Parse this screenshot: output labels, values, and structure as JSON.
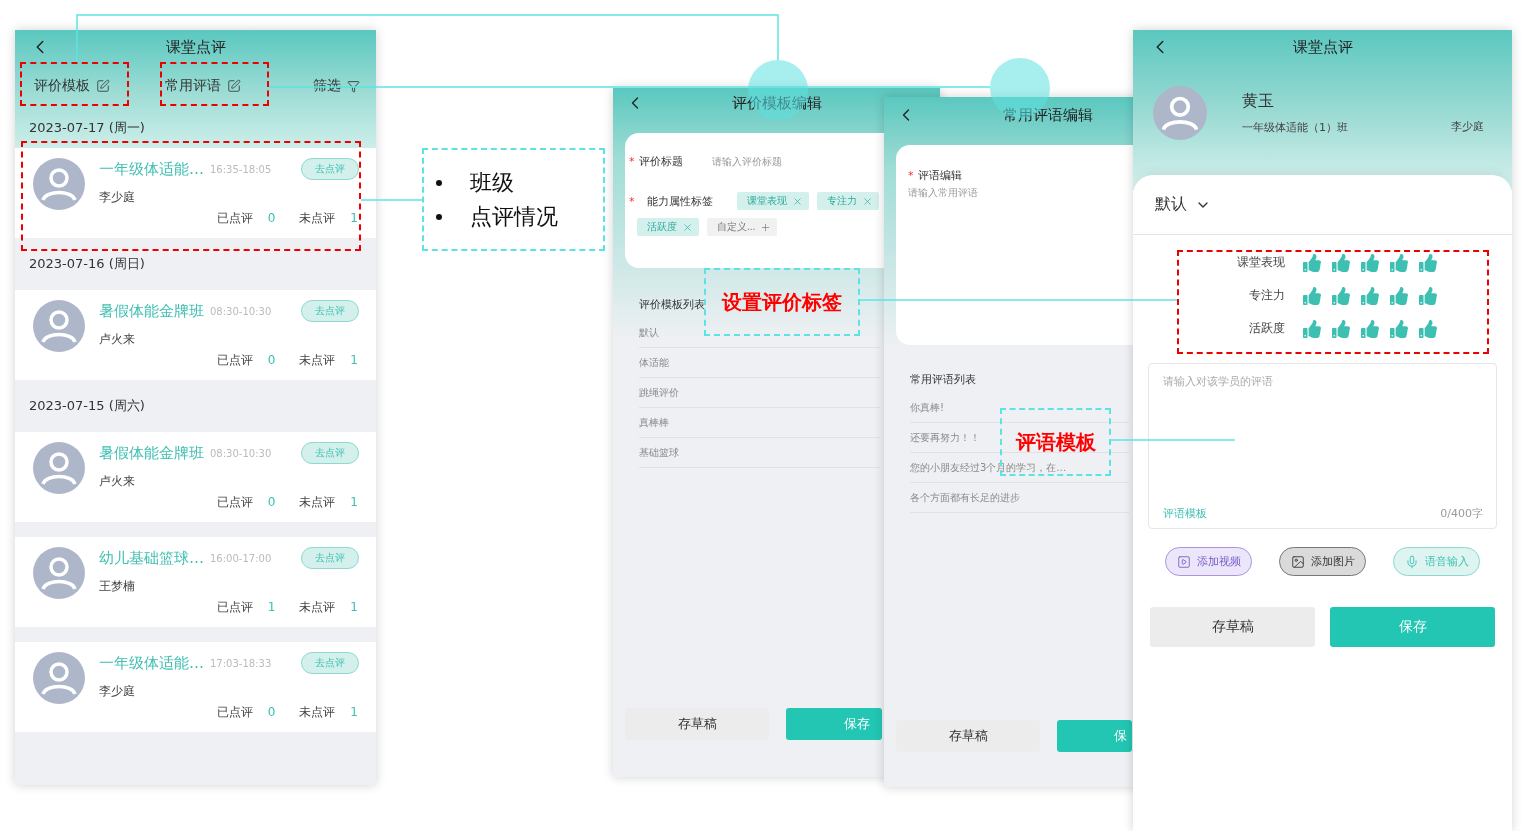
{
  "class_review_list": {
    "title": "课堂点评",
    "tabs": [
      {
        "label": "评价模板"
      },
      {
        "label": "常用评语"
      }
    ],
    "filter": "筛选",
    "sections": [
      {
        "date": "2023-07-17 (周一)",
        "cards": [
          {
            "course": "一年级体适能…",
            "time": "16:35-18:05",
            "action": "去点评",
            "teacher": "李少庭",
            "reviewed_label": "已点评",
            "reviewed": "0",
            "pending_label": "未点评",
            "pending": "1"
          }
        ]
      },
      {
        "date": "2023-07-16 (周日)",
        "cards": [
          {
            "course": "暑假体能金牌班",
            "time": "08:30-10:30",
            "action": "去点评",
            "teacher": "卢火来",
            "reviewed_label": "已点评",
            "reviewed": "0",
            "pending_label": "未点评",
            "pending": "1"
          }
        ]
      },
      {
        "date": "2023-07-15 (周六)",
        "cards": [
          {
            "course": "暑假体能金牌班",
            "time": "08:30-10:30",
            "action": "去点评",
            "teacher": "卢火来",
            "reviewed_label": "已点评",
            "reviewed": "0",
            "pending_label": "未点评",
            "pending": "1"
          },
          {
            "course": "幼儿基础篮球…",
            "time": "16:00-17:00",
            "action": "去点评",
            "teacher": "王梦楠",
            "reviewed_label": "已点评",
            "reviewed": "1",
            "pending_label": "未点评",
            "pending": "1"
          },
          {
            "course": "一年级体适能…",
            "time": "17:03-18:33",
            "action": "去点评",
            "teacher": "李少庭",
            "reviewed_label": "已点评",
            "reviewed": "0",
            "pending_label": "未点评",
            "pending": "1"
          }
        ]
      }
    ]
  },
  "template_editor": {
    "title": "评价模板编辑",
    "title_field": {
      "marker": "*",
      "label": "评价标题",
      "placeholder": "请输入评价标题"
    },
    "tag_field": {
      "marker": "*",
      "label": "能力属性标签"
    },
    "tags": [
      {
        "label": "课堂表现",
        "kind": "removable"
      },
      {
        "label": "专注力",
        "kind": "removable"
      },
      {
        "label": "活跃度",
        "kind": "removable"
      },
      {
        "label": "自定义...",
        "kind": "add"
      }
    ],
    "list_title": "评价模板列表",
    "list": [
      "默认",
      "体适能",
      "跳绳评价",
      "真棒棒",
      "基础篮球"
    ],
    "buttons": [
      {
        "label": "存草稿",
        "kind": "secondary"
      },
      {
        "label": "保存",
        "kind": "primary"
      }
    ]
  },
  "comment_editor": {
    "title": "常用评语编辑",
    "field": {
      "marker": "*",
      "label": "评语编辑",
      "placeholder": "请输入常用评语"
    },
    "list_title": "常用评语列表",
    "list": [
      "你真棒!",
      "还要再努力！！",
      "您的小朋友经过3个月的学习，在…",
      "各个方面都有长足的进步"
    ],
    "buttons": [
      {
        "label": "存草稿",
        "kind": "secondary"
      },
      {
        "label": "保",
        "kind": "primary"
      }
    ]
  },
  "review_form": {
    "title": "课堂点评",
    "student": "黄玉",
    "class_name": "一年级体适能（1）班",
    "teacher": "李少庭",
    "template": "默认",
    "ratings": [
      {
        "label": "课堂表现",
        "stars": 5
      },
      {
        "label": "专注力",
        "stars": 5
      },
      {
        "label": "活跃度",
        "stars": 5
      }
    ],
    "comment": {
      "placeholder": "请输入对该学员的评语",
      "template_link": "评语模板",
      "counter": "0/400字"
    },
    "media_buttons": [
      {
        "label": "添加视频",
        "kind": "video"
      },
      {
        "label": "添加图片",
        "kind": "image"
      },
      {
        "label": "语音输入",
        "kind": "voice"
      }
    ],
    "buttons": [
      {
        "label": "存草稿",
        "kind": "secondary"
      },
      {
        "label": "保存",
        "kind": "primary"
      }
    ]
  },
  "annotations": {
    "list_note": [
      "班级",
      "点评情况"
    ],
    "tag_note": "设置评价标签",
    "comment_note": "评语模板"
  }
}
